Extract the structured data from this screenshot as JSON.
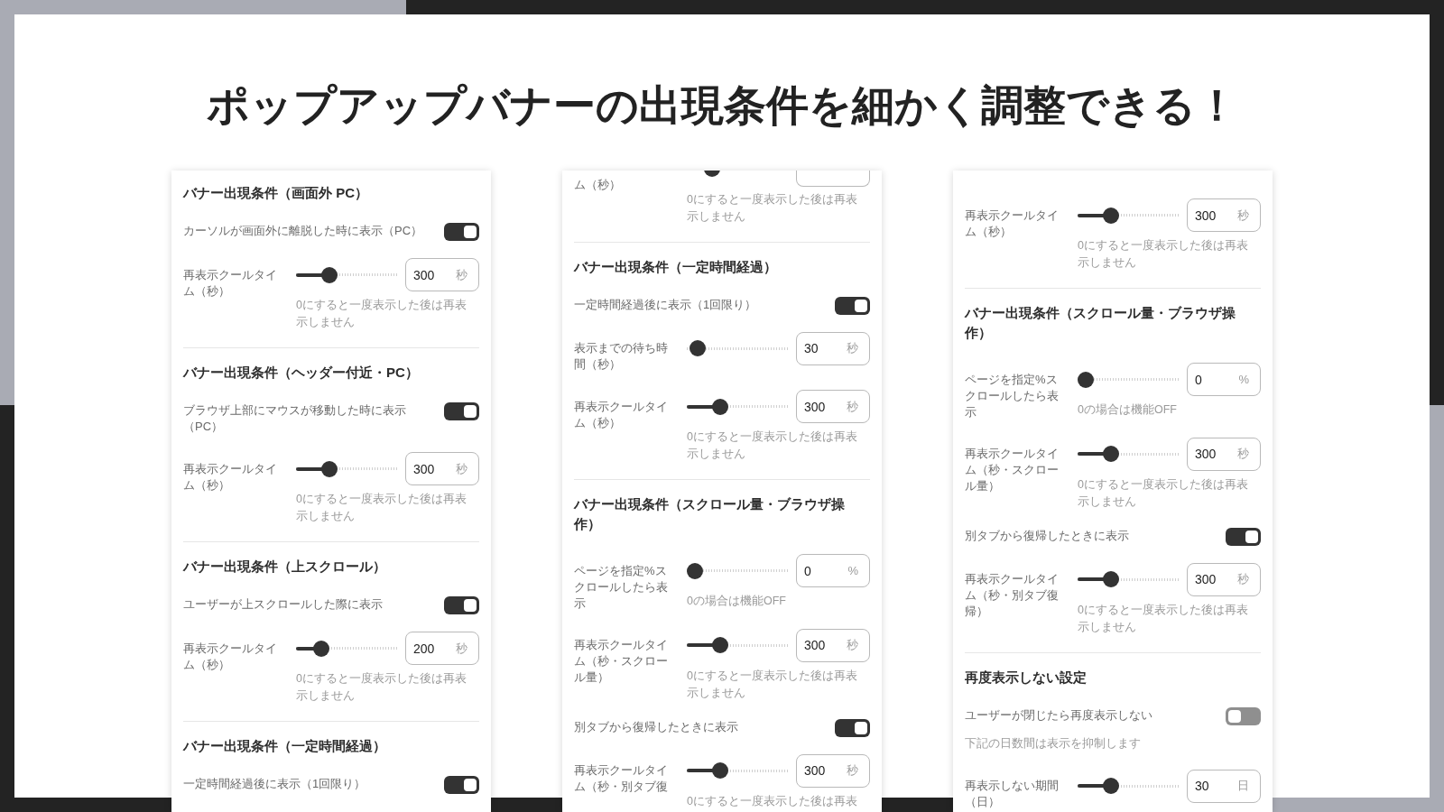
{
  "title": "ポップアップバナーの出現条件を細かく調整できる！",
  "panels": [
    {
      "sections": [
        {
          "heading": "バナー出現条件（画面外 PC）",
          "rows": [
            {
              "kind": "toggle",
              "label": "カーソルが画面外に離脱した時に表示（PC）",
              "on": true
            },
            {
              "kind": "slider",
              "label": "再表示クールタイム（秒）",
              "level": 0.3,
              "value": "300",
              "unit": "秒",
              "hint": "0にすると一度表示した後は再表示しません"
            }
          ]
        },
        {
          "heading": "バナー出現条件（ヘッダー付近・PC）",
          "rows": [
            {
              "kind": "toggle",
              "label": "ブラウザ上部にマウスが移動した時に表示（PC）",
              "on": true
            },
            {
              "kind": "slider",
              "label": "再表示クールタイム（秒）",
              "level": 0.3,
              "value": "300",
              "unit": "秒",
              "hint": "0にすると一度表示した後は再表示しません"
            }
          ]
        },
        {
          "heading": "バナー出現条件（上スクロール）",
          "rows": [
            {
              "kind": "toggle",
              "label": "ユーザーが上スクロールした際に表示",
              "on": true
            },
            {
              "kind": "slider",
              "label": "再表示クールタイム（秒）",
              "level": 0.2,
              "value": "200",
              "unit": "秒",
              "hint": "0にすると一度表示した後は再表示しません"
            }
          ]
        },
        {
          "heading": "バナー出現条件（一定時間経過）",
          "rows": [
            {
              "kind": "toggle",
              "label": "一定時間経過後に表示（1回限り）",
              "on": true
            }
          ]
        }
      ]
    },
    {
      "sections": [
        {
          "rows": [
            {
              "kind": "slider_tail",
              "label": "ム（秒）",
              "level": 0.2,
              "hint": "0にすると一度表示した後は再表示しません"
            }
          ]
        },
        {
          "heading": "バナー出現条件（一定時間経過）",
          "rows": [
            {
              "kind": "toggle",
              "label": "一定時間経過後に表示（1回限り）",
              "on": true
            },
            {
              "kind": "slider",
              "label": "表示までの待ち時間（秒）",
              "level": 0.03,
              "value": "30",
              "unit": "秒"
            },
            {
              "kind": "slider",
              "label": "再表示クールタイム（秒）",
              "level": 0.3,
              "value": "300",
              "unit": "秒",
              "hint": "0にすると一度表示した後は再表示しません"
            }
          ]
        },
        {
          "heading": "バナー出現条件（スクロール量・ブラウザ操作）",
          "rows": [
            {
              "kind": "slider",
              "label": "ページを指定%スクロールしたら表示",
              "level": 0,
              "value": "0",
              "unit": "%",
              "hint": "0の場合は機能OFF"
            },
            {
              "kind": "slider",
              "label": "再表示クールタイム（秒・スクロール量）",
              "level": 0.3,
              "value": "300",
              "unit": "秒",
              "hint": "0にすると一度表示した後は再表示しません"
            },
            {
              "kind": "toggle",
              "label": "別タブから復帰したときに表示",
              "on": true
            },
            {
              "kind": "slider",
              "label": "再表示クールタイム（秒・別タブ復",
              "level": 0.3,
              "value": "300",
              "unit": "秒",
              "hint": "0にすると一度表示した後は再表"
            }
          ]
        }
      ]
    },
    {
      "sections": [
        {
          "rows": [
            {
              "kind": "slider",
              "label": "再表示クールタイム（秒）",
              "level": 0.3,
              "value": "300",
              "unit": "秒",
              "hint": "0にすると一度表示した後は再表示しません"
            }
          ]
        },
        {
          "heading": "バナー出現条件（スクロール量・ブラウザ操作）",
          "rows": [
            {
              "kind": "slider",
              "label": "ページを指定%スクロールしたら表示",
              "level": 0,
              "value": "0",
              "unit": "%",
              "hint": "0の場合は機能OFF"
            },
            {
              "kind": "slider",
              "label": "再表示クールタイム（秒・スクロール量）",
              "level": 0.3,
              "value": "300",
              "unit": "秒",
              "hint": "0にすると一度表示した後は再表示しません"
            },
            {
              "kind": "toggle",
              "label": "別タブから復帰したときに表示",
              "on": true
            },
            {
              "kind": "slider",
              "label": "再表示クールタイム（秒・別タブ復帰）",
              "level": 0.3,
              "value": "300",
              "unit": "秒",
              "hint": "0にすると一度表示した後は再表示しません"
            }
          ]
        },
        {
          "heading": "再度表示しない設定",
          "rows": [
            {
              "kind": "toggle",
              "label": "ユーザーが閉じたら再度表示しない",
              "on": false
            },
            {
              "kind": "note",
              "text": "下記の日数間は表示を抑制します"
            },
            {
              "kind": "slider",
              "label": "再表示しない期間（日）",
              "level": 0.3,
              "value": "30",
              "unit": "日"
            }
          ]
        }
      ]
    }
  ]
}
